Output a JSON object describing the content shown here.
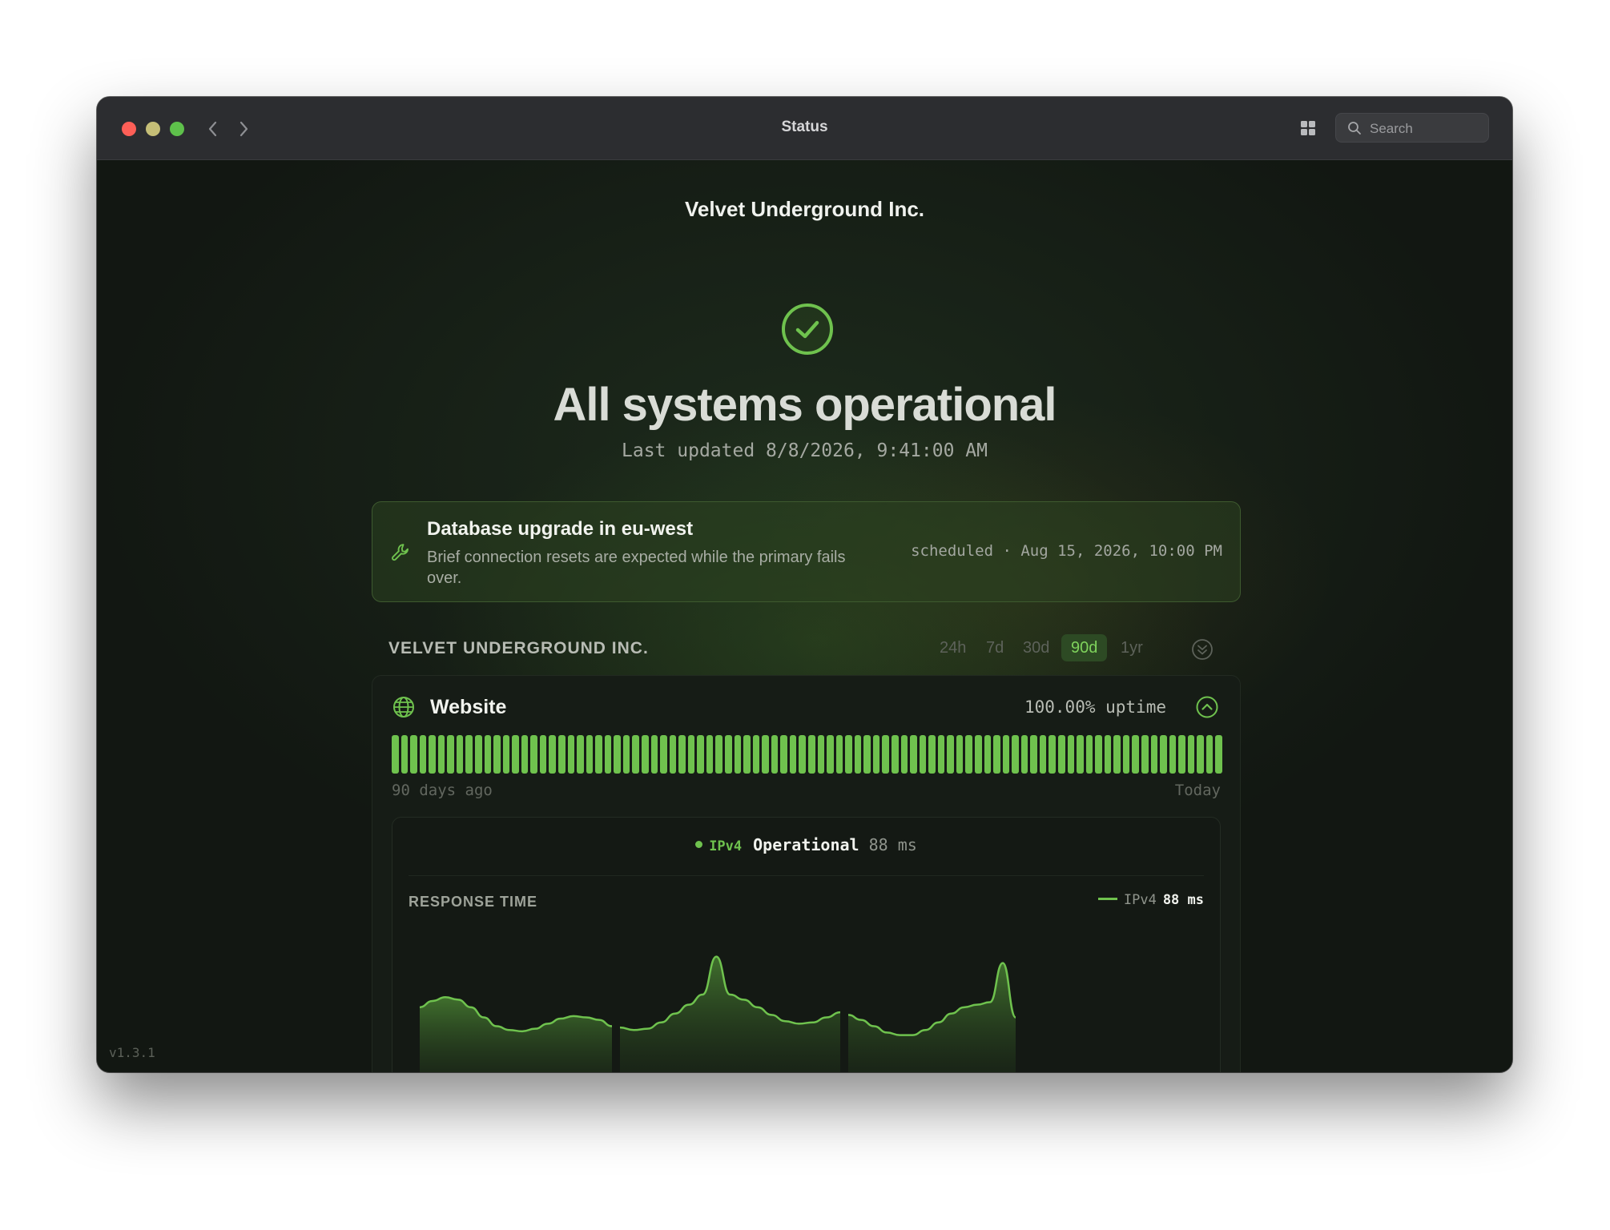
{
  "window": {
    "title": "Status"
  },
  "search": {
    "placeholder": "Search"
  },
  "page": {
    "org_name": "Velvet Underground Inc.",
    "headline": "All systems operational",
    "last_updated": "Last updated 8/8/2026, 9:41:00 AM"
  },
  "notice": {
    "title": "Database upgrade in eu-west",
    "body": "Brief connection resets are expected while the primary fails over.",
    "meta": "scheduled · Aug 15, 2026, 10:00 PM"
  },
  "section": {
    "title": "VELVET UNDERGROUND INC.",
    "ranges": [
      "24h",
      "7d",
      "30d",
      "90d",
      "1yr"
    ],
    "active_range": "90d"
  },
  "service": {
    "name": "Website",
    "uptime": "100.00% uptime",
    "day_count": 90,
    "day_status": "operational",
    "range_start": "90 days ago",
    "range_end": "Today",
    "probe": {
      "name": "IPv4",
      "status": "Operational",
      "latency": "88 ms"
    }
  },
  "chart_data": {
    "type": "area",
    "title": "RESPONSE TIME",
    "series": [
      {
        "name": "IPv4",
        "legend_value": "88 ms",
        "segments": [
          [
            70,
            75,
            78,
            76,
            70,
            62,
            55,
            52,
            51,
            53,
            57,
            61,
            63,
            62,
            60,
            55
          ],
          [
            54,
            52,
            53,
            58,
            65,
            72,
            80,
            110,
            80,
            76,
            70,
            64,
            59,
            57,
            58,
            62,
            66
          ],
          [
            64,
            60,
            55,
            50,
            48,
            48,
            52,
            58,
            65,
            70,
            72,
            74,
            105,
            62
          ]
        ]
      }
    ]
  },
  "colors": {
    "accent": "#6fc24e",
    "background": "#121712"
  },
  "footer": {
    "version": "v1.3.1"
  }
}
